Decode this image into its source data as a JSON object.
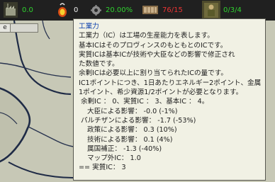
{
  "statusbar": {
    "item1_value": "0.0",
    "item2_value": "0",
    "item3_value": "20.00%",
    "item4_value": "76/15",
    "item5_value": "0/3/4",
    "colors": {
      "green": "#2fd12f",
      "red": "#ea3434",
      "bar_bg": "#202020"
    }
  },
  "map": {
    "tab_label": "e"
  },
  "tooltip": {
    "title": "工業力",
    "lines": [
      "工業力（IC）は工場の生産能力を表します。",
      "基本ICはそのプロヴィンスのもともとのICです。",
      "実質ICは基本ICが技術や大臣などの影響で修正され",
      "た数値です。",
      "余剰ICは必要以上に割り当てられたICの量です。",
      "IC1ポイントにつき、1日あたりエネルギー2ポイント、金属",
      "1ポイント、希少資源1/2ポイントが必要となります。"
    ],
    "summary": "余剰IC ： 0、実質IC ： 3、基本IC ： 4。",
    "effects": [
      "大臣による影響： -0.0 (-1%)",
      "パルチザンによる影響： -1.7 (-53%)",
      "政策による影響： 0.3 (10%)",
      "技術による影響： 0.1 (4%)",
      "属国補正： -1.3 (-40%)",
      "マップ外IC： 1.0"
    ],
    "total": "== 実質IC： 3"
  }
}
